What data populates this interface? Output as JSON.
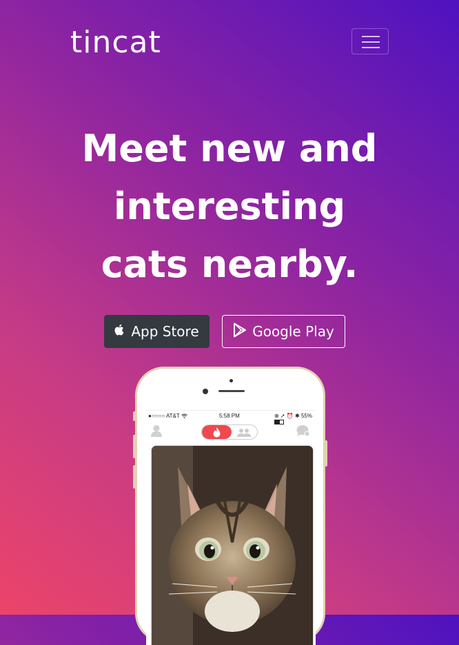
{
  "navbar": {
    "brand": "tincat",
    "menu_toggle_icon": "hamburger-icon"
  },
  "hero": {
    "title_lines": [
      "Meet new and",
      "interesting",
      "cats nearby."
    ]
  },
  "buttons": {
    "app_store": {
      "label": "App Store",
      "icon": "apple-icon"
    },
    "google_play": {
      "label": "Google Play",
      "icon": "play-icon"
    }
  },
  "phone": {
    "status_bar": {
      "carrier": "●○○○○ AT&T",
      "time": "5:58 PM",
      "battery": "55%"
    },
    "app_bar_icons": [
      "profile-icon",
      "flame-icon",
      "group-icon",
      "messages-icon"
    ]
  },
  "colors": {
    "gradient_start": "#ec4469",
    "gradient_end": "#4e12c0",
    "dark_button": "#343a40",
    "tinder_red": "#f0484f"
  }
}
